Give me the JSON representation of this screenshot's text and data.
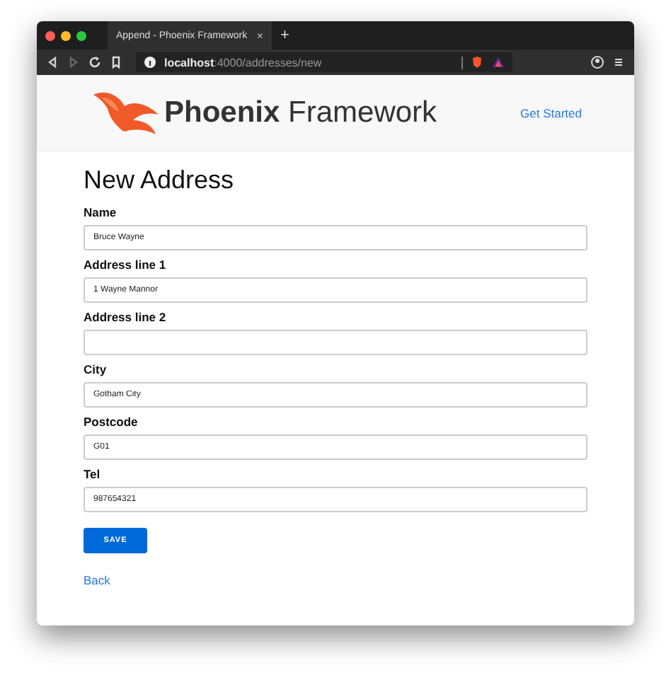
{
  "browser": {
    "tab_title": "Append - Phoenix Framework",
    "tab_close": "×",
    "new_tab": "+",
    "url_host": "localhost",
    "url_path": ":4000/addresses/new"
  },
  "header": {
    "brand_bold": "Phoenix",
    "brand_light": "Framework",
    "nav_link": "Get Started"
  },
  "title": "New Address",
  "fields": [
    {
      "label": "Name",
      "value": "Bruce Wayne"
    },
    {
      "label": "Address line 1",
      "value": "1 Wayne Mannor"
    },
    {
      "label": "Address line 2"
    },
    {
      "label": "City",
      "value": "Gotham City"
    },
    {
      "label": "Postcode",
      "value": "G01"
    },
    {
      "label": "Tel",
      "value": "987654321"
    }
  ],
  "save_button": "SAVE",
  "back_link": "Back"
}
